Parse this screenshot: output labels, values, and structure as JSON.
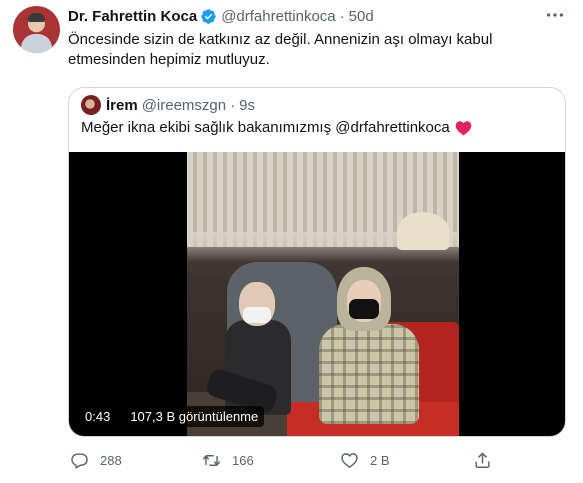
{
  "tweet": {
    "author_name": "Dr. Fahrettin Koca",
    "handle": "@drfahrettinkoca",
    "separator": "·",
    "time": "50d",
    "text": "Öncesinde sizin de katkınız az değil. Annenizin aşı olmayı kabul etmesinden hepimiz mutluyuz.",
    "verified": true,
    "more_icon": "ellipsis-icon"
  },
  "quote": {
    "author_name": "İrem",
    "handle": "@ireemszgn",
    "separator": "·",
    "time": "9s",
    "text": "Meğer ikna ekibi sağlık bakanımızmış @drfahrettinkoca",
    "emoji": "red-heart"
  },
  "video": {
    "duration": "0:43",
    "views": "107,3 B görüntülenme"
  },
  "actions": {
    "reply_count": "288",
    "retweet_count": "166",
    "like_count": "2 B",
    "share_icon": "share-icon"
  },
  "colors": {
    "verified": "#1d9bf0",
    "muted": "#536471",
    "heart": "#e0245e",
    "border": "#cfd9de"
  }
}
